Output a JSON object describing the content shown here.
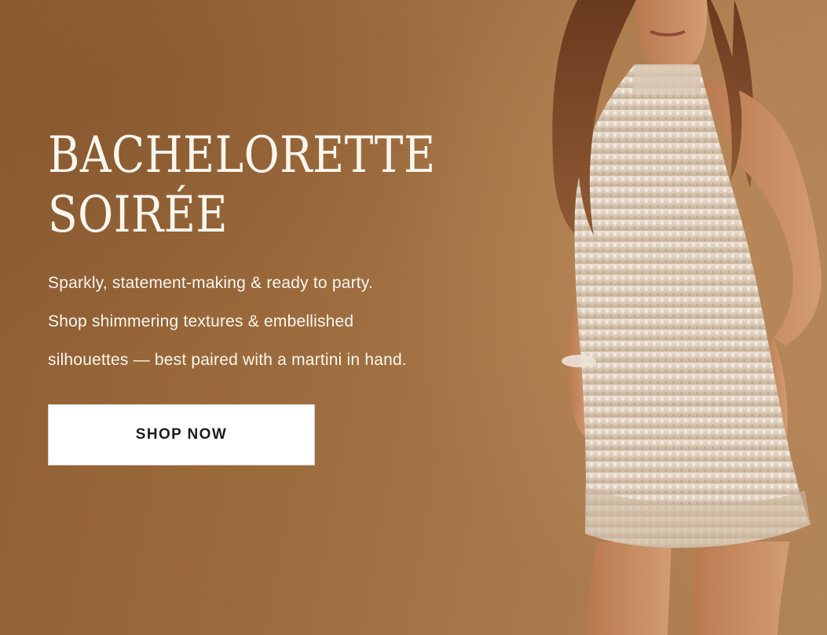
{
  "hero": {
    "headline_line1": "BACHELORETTE",
    "headline_line2": "SOIRÉE",
    "body_line1": "Sparkly, statement-making & ready to party.",
    "body_line2": "Shop shimmering textures & embellished",
    "body_line3": "silhouettes — best paired with a martini in hand.",
    "cta_label": "SHOP NOW"
  },
  "colors": {
    "background": "#9b6a3c",
    "headline_text": "#fbf6ef",
    "cta_background": "#ffffff",
    "cta_text": "#1f1b18"
  }
}
